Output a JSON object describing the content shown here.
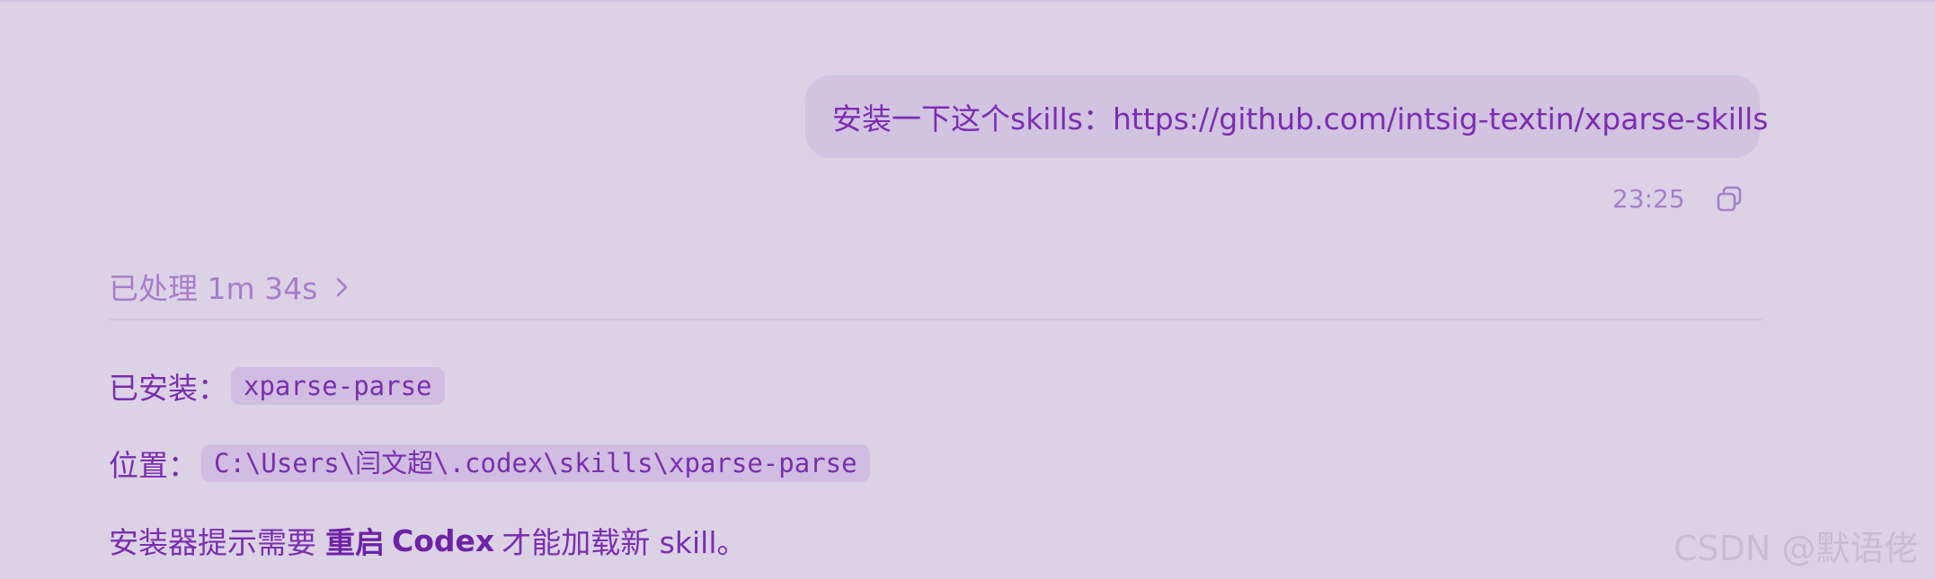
{
  "conversation": {
    "user_message": {
      "text": "安装一下这个skills：https://github.com/intsig-textin/xparse-skills",
      "time": "23:25",
      "copy_icon": "copy-icon"
    },
    "processed": {
      "label": "已处理 1m 34s",
      "icon": "chevron-right-icon"
    },
    "response": {
      "installed_label": "已安装：",
      "installed_value": "xparse-parse",
      "location_label": "位置：",
      "location_value": "C:\\Users\\闫文超\\.codex\\skills\\xparse-parse",
      "note_prefix": "安装器提示需要",
      "note_bold": "重启",
      "note_brand": "Codex",
      "note_suffix": "才能加载新 skill。"
    }
  },
  "watermark": "CSDN @默语佬",
  "colors": {
    "background": "#dcd2e6",
    "bubble": "#d2c3e1",
    "text_purple": "#7a2eaf",
    "muted_purple": "#a97ccb",
    "code_bg": "#d0bde1"
  }
}
